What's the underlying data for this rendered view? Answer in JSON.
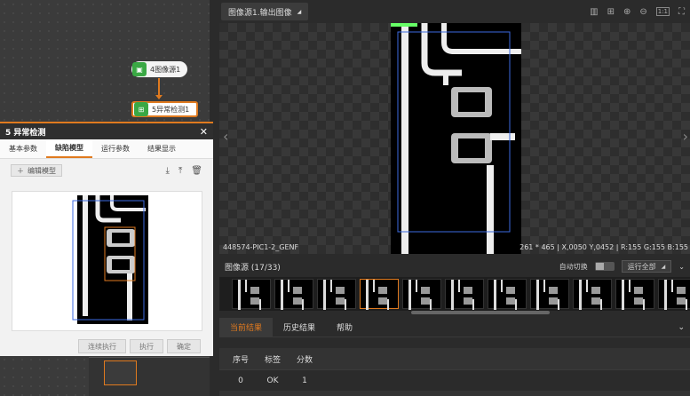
{
  "flow": {
    "node1_label": "4图像源1",
    "node2_label": "5异常检测1"
  },
  "dialog": {
    "title": "5 异常检测",
    "tabs": [
      "基本参数",
      "缺陷模型",
      "运行参数",
      "结果显示"
    ],
    "active_tab": 1,
    "edit_model_label": "编辑模型",
    "footer": {
      "continuous_run": "连续执行",
      "run": "执行",
      "confirm": "确定"
    }
  },
  "viewer": {
    "source_label": "图像源1.输出图像",
    "image_name": "448574-PIC1-2_GENF",
    "pixel_info": "261 * 465 | X,0050 Y,0452 | R:155 G:155 B:155"
  },
  "strip": {
    "title": "图像源 (17/33)",
    "auto_switch_label": "自动切换",
    "run_all_label": "运行全部",
    "thumb_count": 11,
    "selected_index": 3
  },
  "results": {
    "tabs": [
      "当前结果",
      "历史结果",
      "帮助"
    ],
    "active_tab": 0,
    "columns": [
      "序号",
      "标签",
      "分数"
    ],
    "rows": [
      [
        "0",
        "OK",
        "1"
      ]
    ]
  },
  "colors": {
    "accent": "#e07a1f",
    "node_green": "#3aa844"
  }
}
